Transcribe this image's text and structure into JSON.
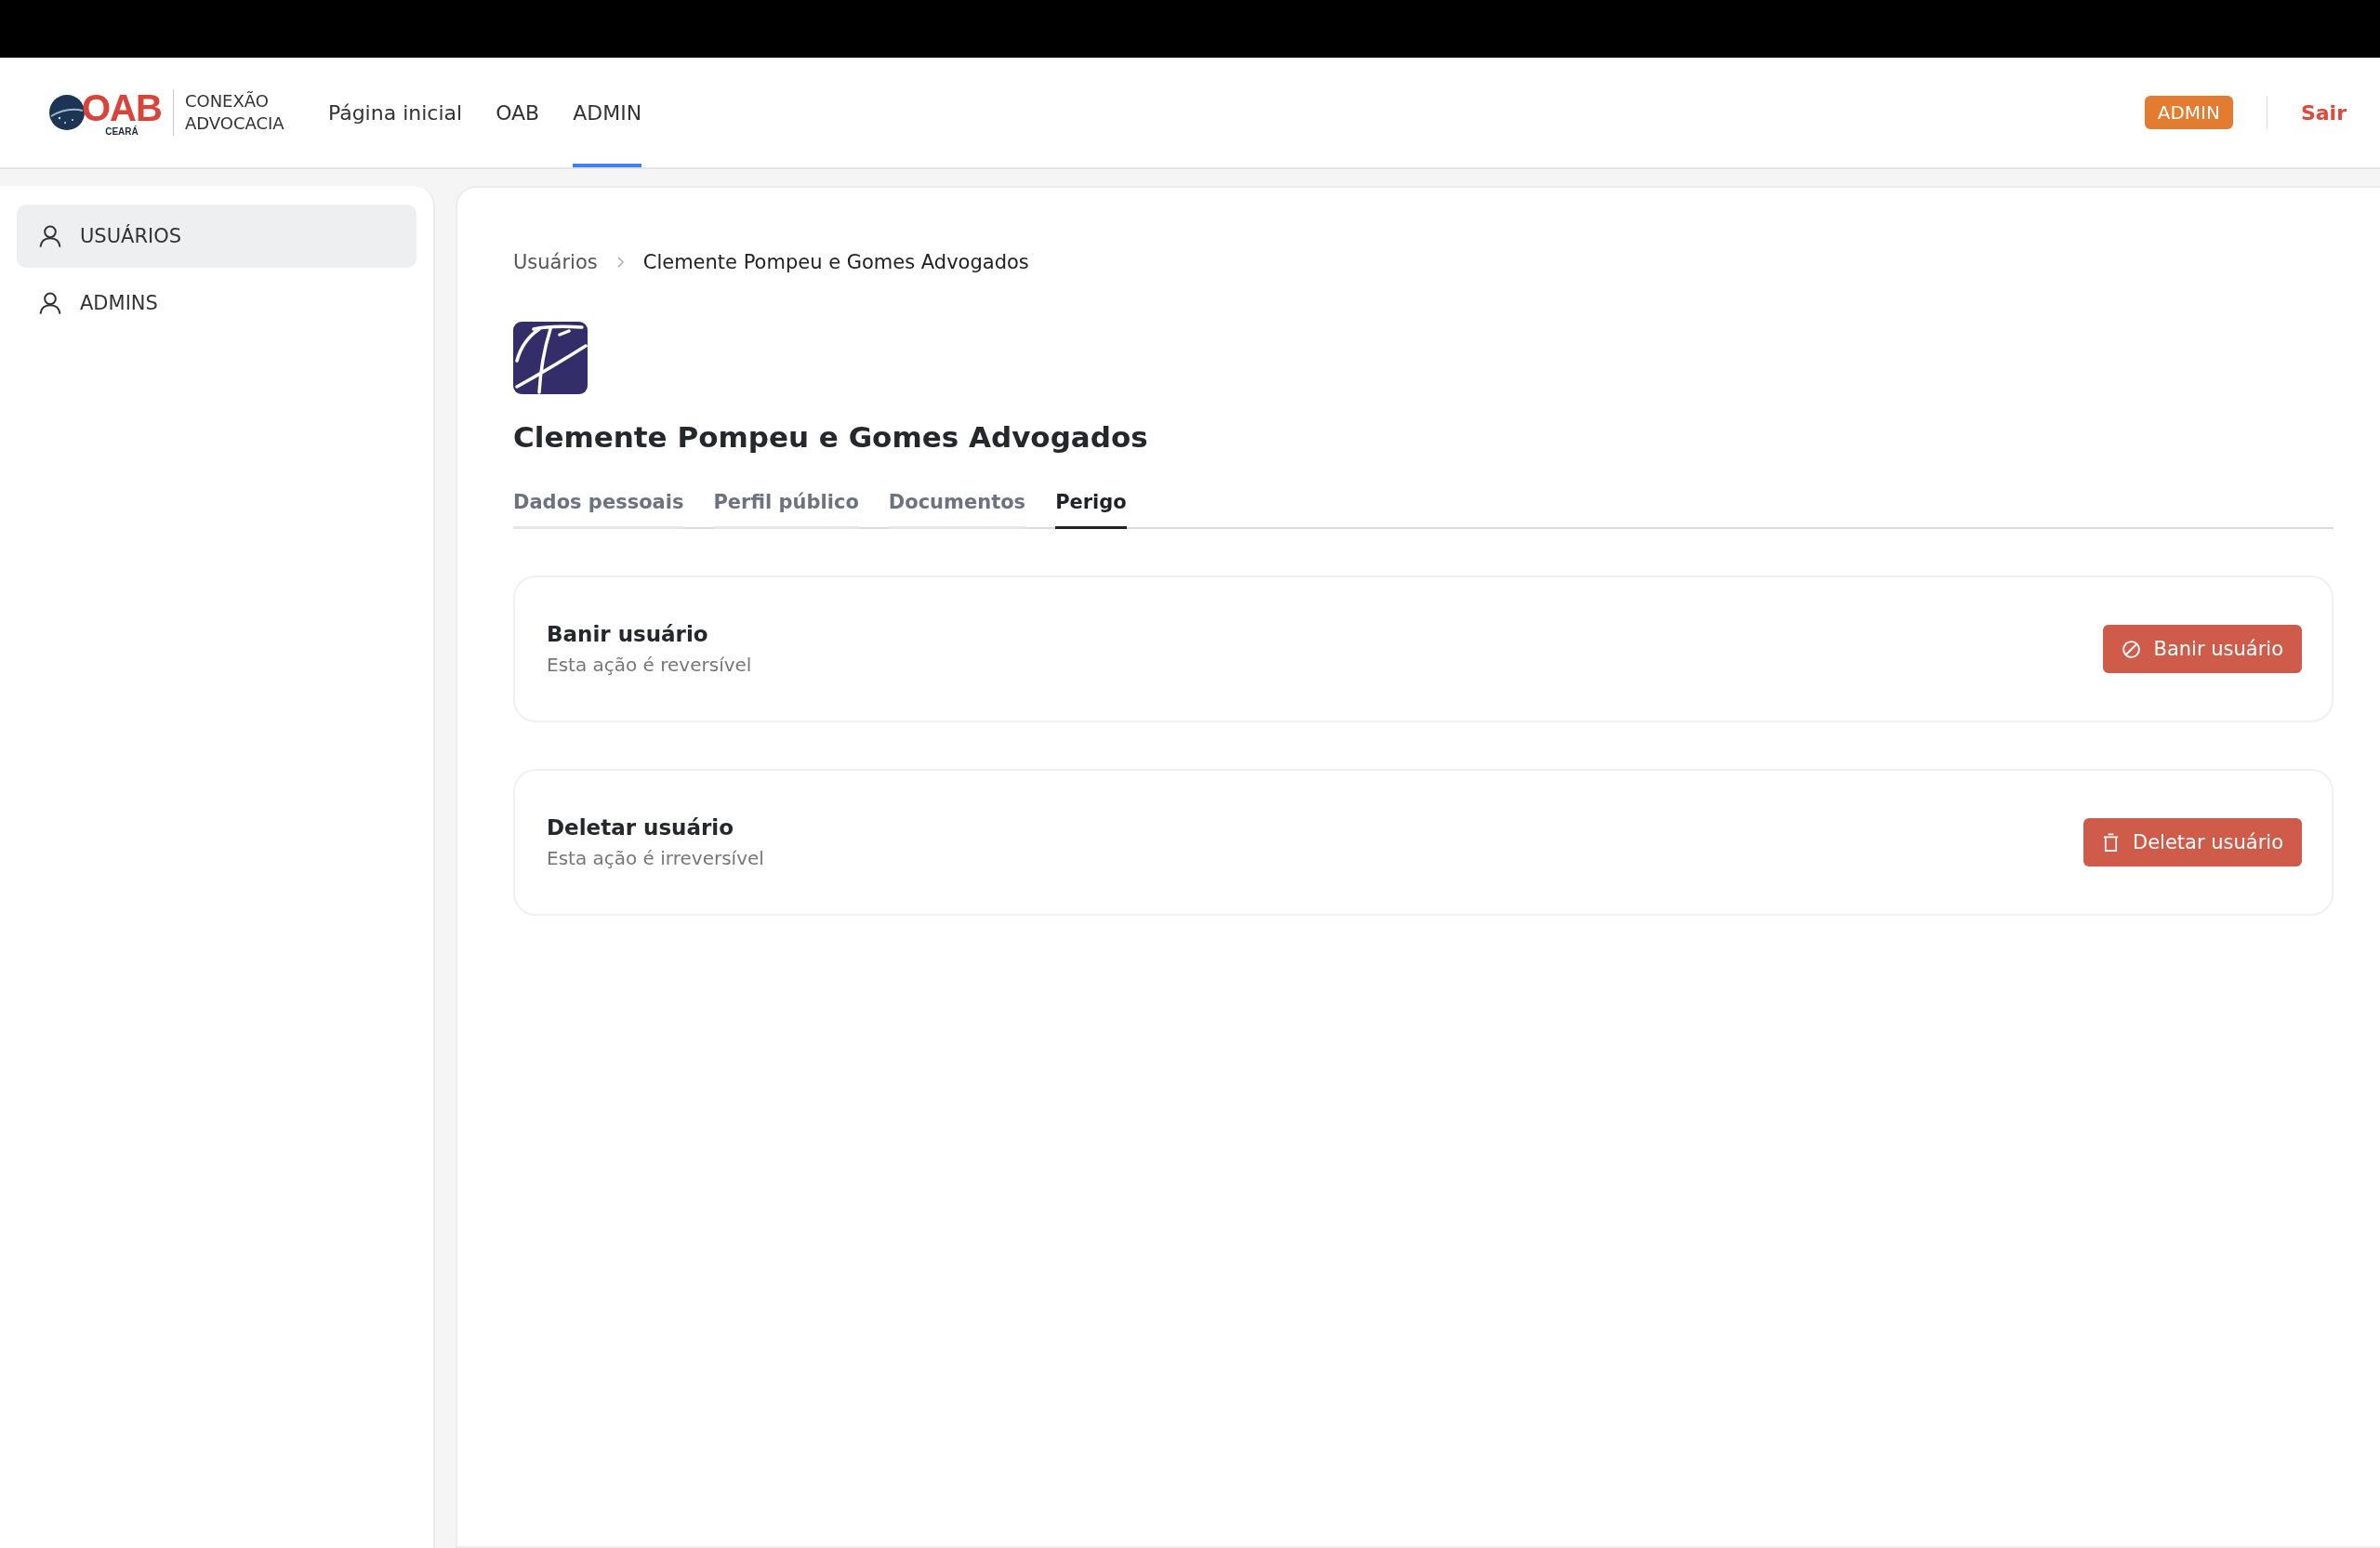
{
  "header": {
    "logo": {
      "letters": "OAB",
      "region": "CEARÁ"
    },
    "brand": "CONEXÃO ADVOCACIA",
    "nav": [
      {
        "label": "Página inicial",
        "selected": false
      },
      {
        "label": "OAB",
        "selected": false
      },
      {
        "label": "ADMIN",
        "selected": true
      }
    ],
    "role_badge": "ADMIN",
    "logout": "Sair"
  },
  "sidebar": {
    "items": [
      {
        "label": "USUÁRIOS",
        "selected": true
      },
      {
        "label": "ADMINS",
        "selected": false
      }
    ]
  },
  "breadcrumb": [
    "Usuários",
    "Clemente Pompeu e Gomes Advogados"
  ],
  "profile": {
    "name": "Clemente Pompeu e Gomes Advogados"
  },
  "tabs": [
    {
      "label": "Dados pessoais",
      "selected": false
    },
    {
      "label": "Perfil público",
      "selected": false
    },
    {
      "label": "Documentos",
      "selected": false
    },
    {
      "label": "Perigo",
      "selected": true
    }
  ],
  "actions": [
    {
      "kind": "ban",
      "title": "Banir usuário",
      "subtitle": "Esta ação é reversível",
      "button": "Banir usuário"
    },
    {
      "kind": "delete",
      "title": "Deletar usuário",
      "subtitle": "Esta ação é irreversível",
      "button": "Deletar usuário"
    }
  ]
}
